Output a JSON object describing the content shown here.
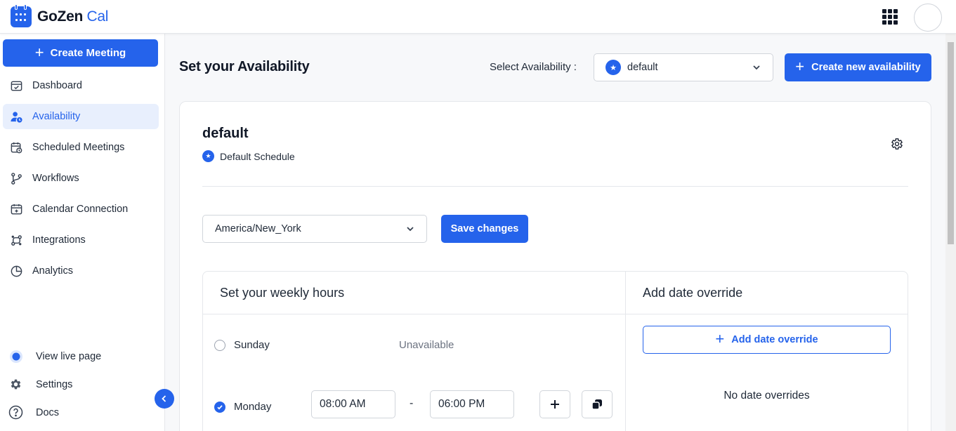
{
  "app": {
    "name_main": "GoZen",
    "name_accent": "Cal"
  },
  "sidebar": {
    "create_label": "Create Meeting",
    "items": [
      {
        "label": "Dashboard",
        "icon": "dashboard-icon"
      },
      {
        "label": "Availability",
        "icon": "availability-icon",
        "active": true
      },
      {
        "label": "Scheduled Meetings",
        "icon": "calendar-clock-icon"
      },
      {
        "label": "Workflows",
        "icon": "workflow-icon"
      },
      {
        "label": "Calendar Connection",
        "icon": "calendar-plus-icon"
      },
      {
        "label": "Integrations",
        "icon": "integrations-icon"
      },
      {
        "label": "Analytics",
        "icon": "pie-chart-icon"
      }
    ],
    "bottom": [
      {
        "label": "View live page",
        "icon": "live-dot-icon"
      },
      {
        "label": "Settings",
        "icon": "gear-icon"
      },
      {
        "label": "Docs",
        "icon": "help-icon"
      }
    ]
  },
  "header": {
    "title": "Set your Availability",
    "select_label": "Select Availability :",
    "selected_availability": "default",
    "create_new_label": "Create new availability"
  },
  "schedule": {
    "name": "default",
    "tag": "Default Schedule",
    "timezone": "America/New_York",
    "save_label": "Save changes"
  },
  "weekly": {
    "title": "Set your weekly hours",
    "unavailable_text": "Unavailable",
    "days": [
      {
        "name": "Sunday",
        "enabled": false
      },
      {
        "name": "Monday",
        "enabled": true,
        "start": "08:00 AM",
        "end": "06:00 PM"
      }
    ],
    "separator": "-"
  },
  "overrides": {
    "title": "Add date override",
    "add_label": "Add date override",
    "empty_text": "No date overrides"
  },
  "colors": {
    "primary": "#2563eb",
    "active_bg": "#e8effd"
  }
}
